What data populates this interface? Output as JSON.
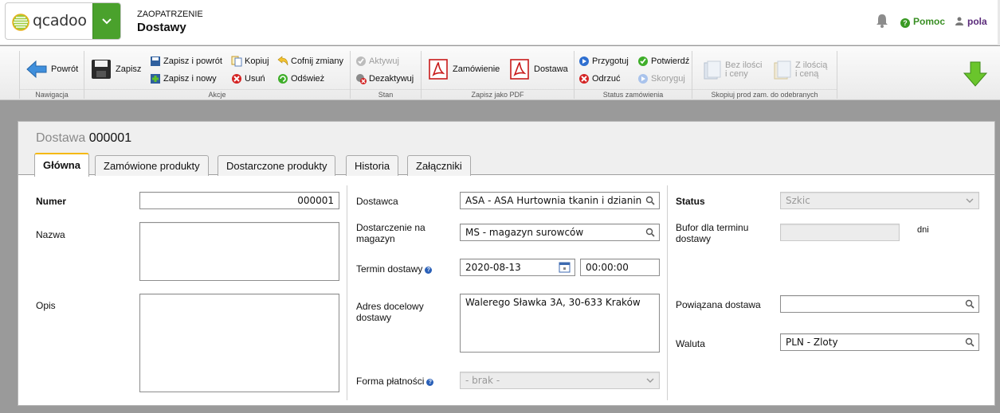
{
  "header": {
    "logo_text": "qcadoo",
    "section": "ZAOPATRZENIE",
    "page": "Dostawy",
    "help_label": "Pomoc",
    "user_label": "pola",
    "accent": "#4aa12c"
  },
  "ribbon": {
    "groups": {
      "navigation": "Nawigacja",
      "actions": "Akcje",
      "state": "Stan",
      "pdf": "Zapisz jako PDF",
      "order_status": "Status zamówienia",
      "copy": "Skopiuj prod zam. do odebranych"
    },
    "back": "Powrót",
    "save": "Zapisz",
    "save_back": "Zapisz i powrót",
    "save_new": "Zapisz i nowy",
    "copy": "Kopiuj",
    "delete": "Usuń",
    "undo": "Cofnij zmiany",
    "refresh": "Odśwież",
    "activate": "Aktywuj",
    "deactivate": "Dezaktywuj",
    "order_pdf": "Zamówienie",
    "delivery_pdf": "Dostawa",
    "prepare": "Przygotuj",
    "confirm": "Potwierdź",
    "reject": "Odrzuć",
    "finish": "Skoryguj",
    "without_qty_1": "Bez ilości",
    "without_qty_2": "i ceny",
    "with_qty_1": "Z ilością",
    "with_qty_2": "i ceną"
  },
  "form": {
    "title_label": "Dostawa",
    "title_number": "000001",
    "tabs": [
      "Główna",
      "Zamówione produkty",
      "Dostarczone produkty",
      "Historia",
      "Załączniki"
    ],
    "number_label": "Numer",
    "number_value": "000001",
    "name_label": "Nazwa",
    "description_label": "Opis",
    "supplier_label": "Dostawca",
    "supplier_value": "ASA - ASA Hurtownia tkanin i dzianin",
    "delivery_to_label_1": "Dostarczenie na",
    "delivery_to_label_2": "magazyn",
    "delivery_to_value": "MS - magazyn surowców",
    "delivery_date_label": "Termin dostawy",
    "delivery_date_value": "2020-08-13",
    "delivery_time_value": "00:00:00",
    "address_label_1": "Adres docelowy",
    "address_label_2": "dostawy",
    "address_value": "Walerego Sławka 3A, 30-633 Kraków",
    "payment_label": "Forma płatności",
    "payment_value": "- brak -",
    "status_label": "Status",
    "status_value": "Szkic",
    "buffer_label_1": "Bufor dla terminu",
    "buffer_label_2": "dostawy",
    "buffer_unit": "dni",
    "related_label": "Powiązana dostawa",
    "currency_label": "Waluta",
    "currency_value": "PLN - Zloty"
  },
  "icons": [
    "bell-icon",
    "help-icon",
    "user-icon",
    "back-arrow-icon",
    "save-icon",
    "pdf-icon",
    "lookup-search-icon",
    "calendar-icon",
    "download-arrow-icon"
  ]
}
